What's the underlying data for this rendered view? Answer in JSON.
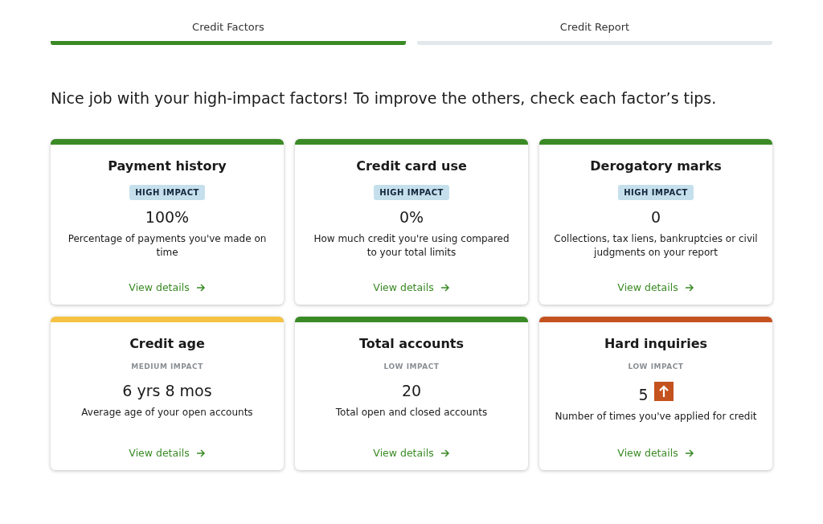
{
  "tabs": [
    {
      "label": "Credit Factors",
      "selected": true
    },
    {
      "label": "Credit Report",
      "selected": false
    }
  ],
  "message": "Nice job with your high-impact factors! To improve the others, check each factor’s tips.",
  "factors": [
    {
      "title": "Payment history",
      "impact": "HIGH IMPACT",
      "kind": "high",
      "color": "#3a8a25",
      "value": "100%",
      "flagged": false,
      "description": "Percentage of payments you've made on time",
      "link": "View details"
    },
    {
      "title": "Credit card use",
      "impact": "HIGH IMPACT",
      "kind": "high",
      "color": "#3a8a25",
      "value": "0%",
      "flagged": false,
      "description": "How much credit you're using compared to your total limits",
      "link": "View details"
    },
    {
      "title": "Derogatory marks",
      "impact": "HIGH IMPACT",
      "kind": "high",
      "color": "#3a8a25",
      "value": "0",
      "flagged": false,
      "description": "Collections, tax liens, bankruptcies or civil judgments on your report",
      "link": "View details"
    },
    {
      "title": "Credit age",
      "impact": "MEDIUM IMPACT",
      "kind": "medium",
      "color": "#f5c242",
      "value": "6 yrs 8 mos",
      "flagged": false,
      "description": "Average age of your open accounts",
      "link": "View details"
    },
    {
      "title": "Total accounts",
      "impact": "LOW IMPACT",
      "kind": "low",
      "color": "#3a8a25",
      "value": "20",
      "flagged": false,
      "description": "Total open and closed accounts",
      "link": "View details"
    },
    {
      "title": "Hard inquiries",
      "impact": "LOW IMPACT",
      "kind": "low",
      "color": "#c4521f",
      "value": "5",
      "flagged": true,
      "description": "Number of times you've applied for credit",
      "link": "View details"
    }
  ]
}
